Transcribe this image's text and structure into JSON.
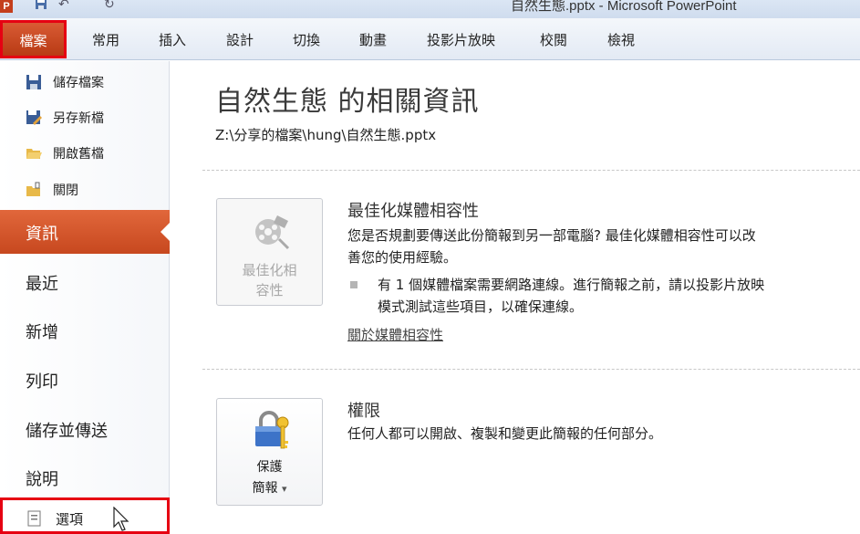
{
  "titlebar": {
    "app_logo": "P",
    "window_title": "自然生態.pptx - Microsoft PowerPoint",
    "qat_icons": [
      "save-icon",
      "undo-icon",
      "redo-icon"
    ]
  },
  "ribbon": {
    "file_tab": "檔案",
    "tabs": [
      "常用",
      "插入",
      "設計",
      "切換",
      "動畫",
      "投影片放映",
      "校閱",
      "檢視"
    ]
  },
  "backstage": {
    "commands": [
      "儲存檔案",
      "另存新檔",
      "開啟舊檔",
      "關閉"
    ],
    "selected": "資訊",
    "items": [
      "最近",
      "新增",
      "列印",
      "儲存並傳送",
      "說明"
    ],
    "options": "選項"
  },
  "info": {
    "title": "自然生態 的相關資訊",
    "path": "Z:\\分享的檔案\\hung\\自然生態.pptx",
    "media": {
      "button_line1": "最佳化相",
      "button_line2": "容性",
      "heading": "最佳化媒體相容性",
      "desc_line1": "您是否規劃要傳送此份簡報到另一部電腦? 最佳化媒體相容性可以改",
      "desc_line2": "善您的使用經驗。",
      "bullet_line1": "有 1 個媒體檔案需要網路連線。進行簡報之前，請以投影片放映",
      "bullet_line2": "模式測試這些項目，以確保連線。",
      "link": "關於媒體相容性"
    },
    "permissions": {
      "button_line1": "保護",
      "button_line2": "簡報",
      "dropdown_glyph": "▾",
      "heading": "權限",
      "desc": "任何人都可以開啟、複製和變更此簡報的任何部分。"
    }
  },
  "colors": {
    "file_tab": "#c7481f",
    "highlight_border": "#e60012",
    "selected_item": "#d4572b"
  }
}
